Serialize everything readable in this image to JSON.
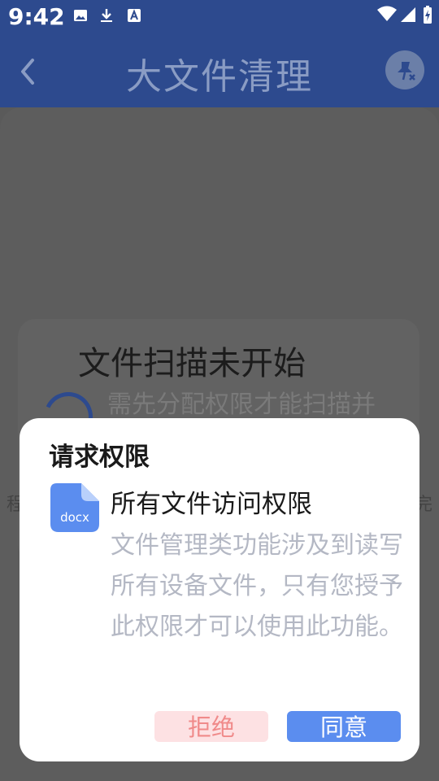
{
  "status_bar": {
    "time": "9:42"
  },
  "app_bar": {
    "title": "大文件清理"
  },
  "scan": {
    "title": "文件扫描未开始",
    "subtitle": "需先分配权限才能扫描并",
    "left_edge_text": "程",
    "right_edge_text": "完"
  },
  "dialog": {
    "title": "请求权限",
    "icon_label": "docx",
    "permission_name": "所有文件访问权限",
    "permission_desc": "文件管理类功能涉及到读写所有设备文件，只有您授予此权限才可以使用此功能。",
    "deny_label": "拒绝",
    "agree_label": "同意"
  },
  "colors": {
    "primary": "#2d4a8e",
    "accent_blue": "#5b8def",
    "deny_bg": "#fde1e3",
    "deny_text": "#f08a8a"
  }
}
